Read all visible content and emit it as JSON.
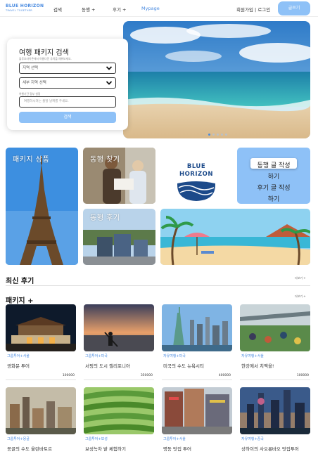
{
  "header": {
    "logo_main": "BLUE HORIZON",
    "logo_sub": "TRAVEL TOGETHER",
    "nav": [
      "검색",
      "동행 +",
      "후기 +",
      "Mypage"
    ],
    "auth": "회원가입 | 로그인",
    "write_button": "글쓰기"
  },
  "search": {
    "title": "여행 패키지 검색",
    "description": "블루호라이즌에서 아름다운 추억을 채워보세요.",
    "region_select": "지역 선택",
    "subregion_select": "세부 지역 선택",
    "date_label": "여행기간 정부 설정",
    "date_placeholder": "여행하시려는 출발 날짜를 주세요.",
    "search_button": "검색"
  },
  "hero": {
    "slides": 5,
    "active_slide": 1
  },
  "tiles": {
    "package": "패키지 상품",
    "companion": "동행 찾기",
    "review": "동행 후기",
    "brand_line1": "BLUE",
    "brand_line2": "HORIZON",
    "cta_line1": "동행 글 작성",
    "cta_line2": "하기",
    "cta_line3": "후기 글 작성",
    "cta_line4": "하기"
  },
  "sections": {
    "latest_reviews": "최신 후기",
    "packages": "패키지 +",
    "more": "더보기 +"
  },
  "packages": [
    {
      "tag": "그룹투어+서울",
      "title": "광화문 투어",
      "price": "100000"
    },
    {
      "tag": "그룹투어+미국",
      "title": "서핑의 도시 캘리포니아",
      "price": "350000"
    },
    {
      "tag": "자유여행+미국",
      "title": "미국의 수도 뉴욕시티",
      "price": "400000"
    },
    {
      "tag": "자유여행+서울",
      "title": "한강에서 치맥을!",
      "price": "100000"
    },
    {
      "tag": "그룹투어+몽골",
      "title": "몽골의 수도 울란바토르",
      "price": ""
    },
    {
      "tag": "그룹투어+보성",
      "title": "보성녹차 밭 체험하기",
      "price": ""
    },
    {
      "tag": "그룹투어+서울",
      "title": "명동 맛집 투어",
      "price": ""
    },
    {
      "tag": "자유여행+중국",
      "title": "상하이의 사오롱바오 맛집투어",
      "price": ""
    }
  ],
  "colors": {
    "accent": "#8ec1f7",
    "brand": "#4a8be0",
    "navy": "#1c4a8a"
  }
}
